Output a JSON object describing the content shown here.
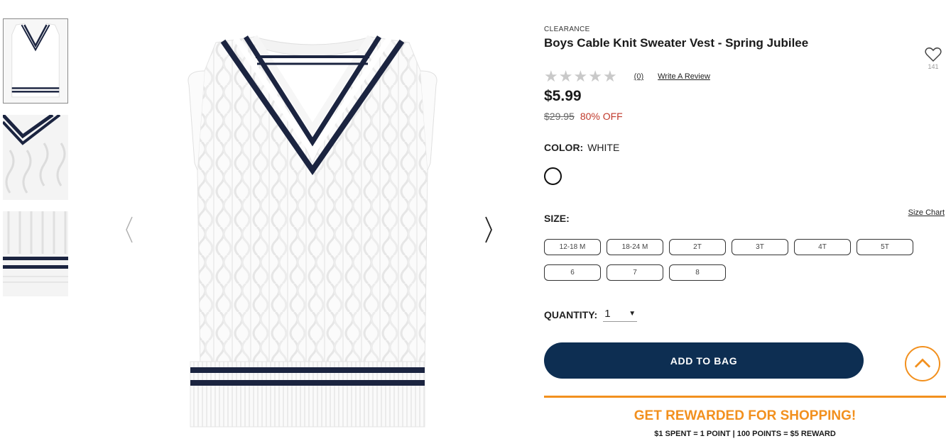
{
  "thumbnails": [
    {
      "label": "thumbnail-1"
    },
    {
      "label": "thumbnail-2"
    },
    {
      "label": "thumbnail-3"
    }
  ],
  "product": {
    "eyebrow": "CLEARANCE",
    "title": "Boys Cable Knit Sweater Vest - Spring Jubilee",
    "wishlist_count": "141",
    "rating_stars": 0,
    "review_count": "(0)",
    "write_review": "Write A Review",
    "price": "$5.99",
    "was_price": "$29.95",
    "discount": "80% OFF"
  },
  "color": {
    "label": "COLOR:",
    "value": "WHITE",
    "swatch_hex": "#ffffff"
  },
  "size": {
    "label": "SIZE:",
    "chart_link": "Size Chart",
    "options": [
      "12-18 M",
      "18-24 M",
      "2T",
      "3T",
      "4T",
      "5T",
      "6",
      "7",
      "8"
    ]
  },
  "quantity": {
    "label": "QUANTITY:",
    "value": "1"
  },
  "cta": {
    "add_to_bag": "ADD TO BAG"
  },
  "rewards": {
    "title": "GET REWARDED FOR SHOPPING!",
    "subtitle": "$1 SPENT = 1 POINT | 100 POINTS = $5 REWARD"
  },
  "colors": {
    "navy": "#0d2e52",
    "orange": "#f2901e",
    "sale_red": "#c0392b"
  }
}
